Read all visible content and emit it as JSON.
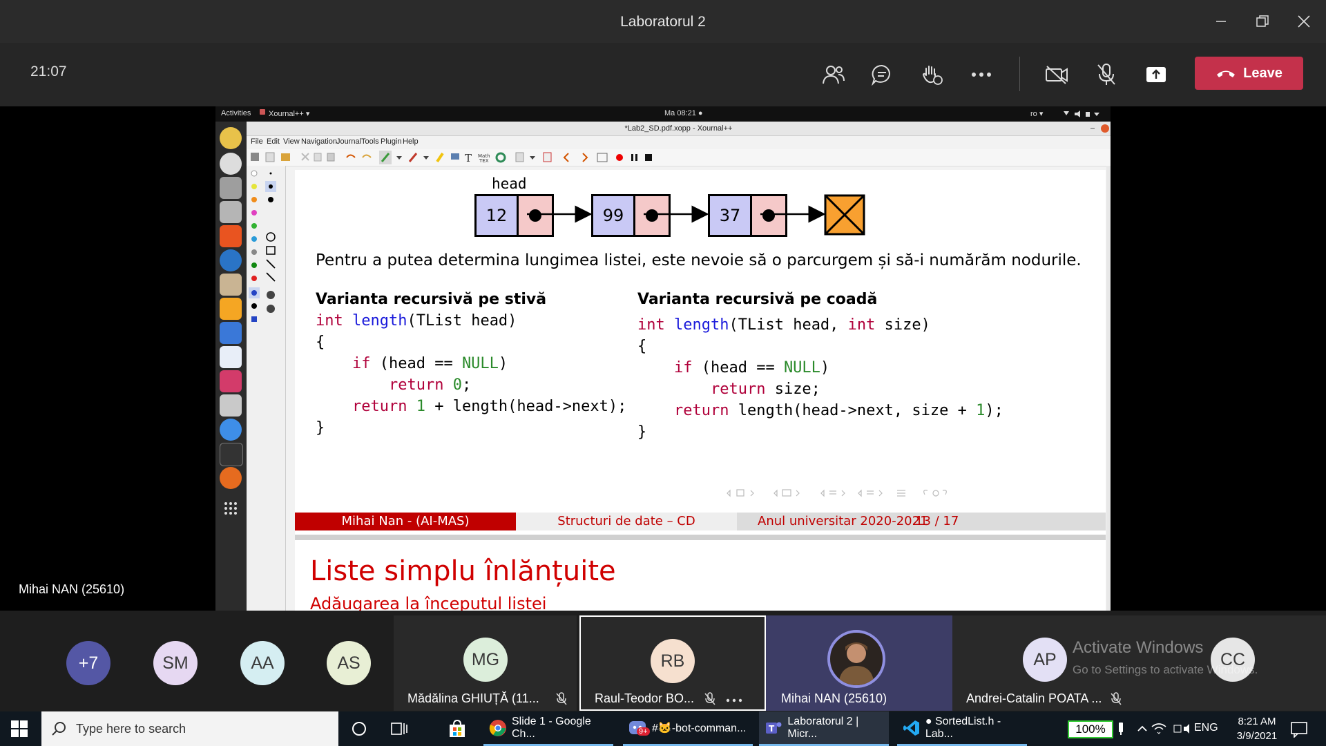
{
  "window": {
    "title": "Laboratorul 2"
  },
  "call": {
    "time": "21:07",
    "leave_label": "Leave",
    "presenter_name": "Mihai NAN (25610)"
  },
  "ubuntu": {
    "activities": "Activities",
    "app": "Xournal++ ▾",
    "clock": "Ma 08:21 ●",
    "lang": "ro ▾"
  },
  "xournal": {
    "title": "*Lab2_SD.pdf.xopp - Xournal++",
    "menu": [
      "File",
      "Edit",
      "View",
      "Navigation",
      "Journal",
      "Tools",
      "Plugin",
      "Help"
    ]
  },
  "slide": {
    "head_label": "head",
    "nodes": [
      "12",
      "99",
      "37"
    ],
    "sentence": "Pentru a putea determina lungimea listei, este nevoie să o parcurgem și să-i numărăm nodurile.",
    "left_title": "Varianta recursivă pe stivă",
    "right_title": "Varianta recursivă pe coadă",
    "footer_author": "Mihai Nan - (AI-MAS)",
    "footer_course": "Structuri de date – CD",
    "footer_year": "Anul universitar 2020-2021",
    "footer_page": "13 / 17",
    "next_title": "Liste simplu înlănțuite",
    "next_subtitle": "Adăugarea la începutul listei"
  },
  "code_left": {
    "l1_kw": "int",
    "l1_fn": "length",
    "l1_rest": "(TList head)",
    "l2": "{",
    "l3_kw": "if",
    "l3_a": " (head == ",
    "l3_nul": "NULL",
    "l3_b": ")",
    "l4_kw": "return",
    "l4_num": " 0",
    "l4_b": ";",
    "l5_kw": "return",
    "l5_num": " 1",
    "l5_b": " + length(head->next);",
    "l6": "}"
  },
  "code_right": {
    "l1_kw": "int",
    "l1_fn": "length",
    "l1_a": "(TList head, ",
    "l1_kw2": "int",
    "l1_b": " size)",
    "l2": "{",
    "l3_kw": "if",
    "l3_a": " (head == ",
    "l3_nul": "NULL",
    "l3_b": ")",
    "l4_kw": "return",
    "l4_b": " size;",
    "l5_kw": "return",
    "l5_b": " length(head->next, size + ",
    "l5_num": "1",
    "l5_c": ");",
    "l6": "}"
  },
  "participants": {
    "overflow": "+7",
    "small": [
      {
        "initials": "SM",
        "color": "#e6d8f2"
      },
      {
        "initials": "AA",
        "color": "#d5eef2"
      },
      {
        "initials": "AS",
        "color": "#e8efd5"
      }
    ],
    "tiles": [
      {
        "initials": "MG",
        "name": "Mădălina GHIUȚĂ (11...",
        "color": "#dceedb"
      },
      {
        "initials": "RB",
        "name": "Raul-Teodor BO...",
        "color": "#f6e0cf"
      },
      {
        "initials": "",
        "name": "Mihai NAN (25610)",
        "color": "#3d3d66"
      },
      {
        "initials": "AP",
        "name": "Andrei-Catalin POATA ...",
        "color": "#e3e0f5"
      },
      {
        "initials": "CC",
        "name": "",
        "color": "#e6e6e6"
      }
    ],
    "activate_title": "Activate Windows",
    "activate_sub": "Go to Settings to activate Windows."
  },
  "taskbar": {
    "search_placeholder": "Type here to search",
    "apps": [
      "Slide 1 - Google Ch...",
      "#🐱-bot-comman...",
      "Laboratorul 2 | Micr...",
      "● SortedList.h - Lab..."
    ],
    "badge": "9+",
    "battery": "100%",
    "lang": "ENG",
    "time": "8:21 AM",
    "date": "3/9/2021"
  }
}
